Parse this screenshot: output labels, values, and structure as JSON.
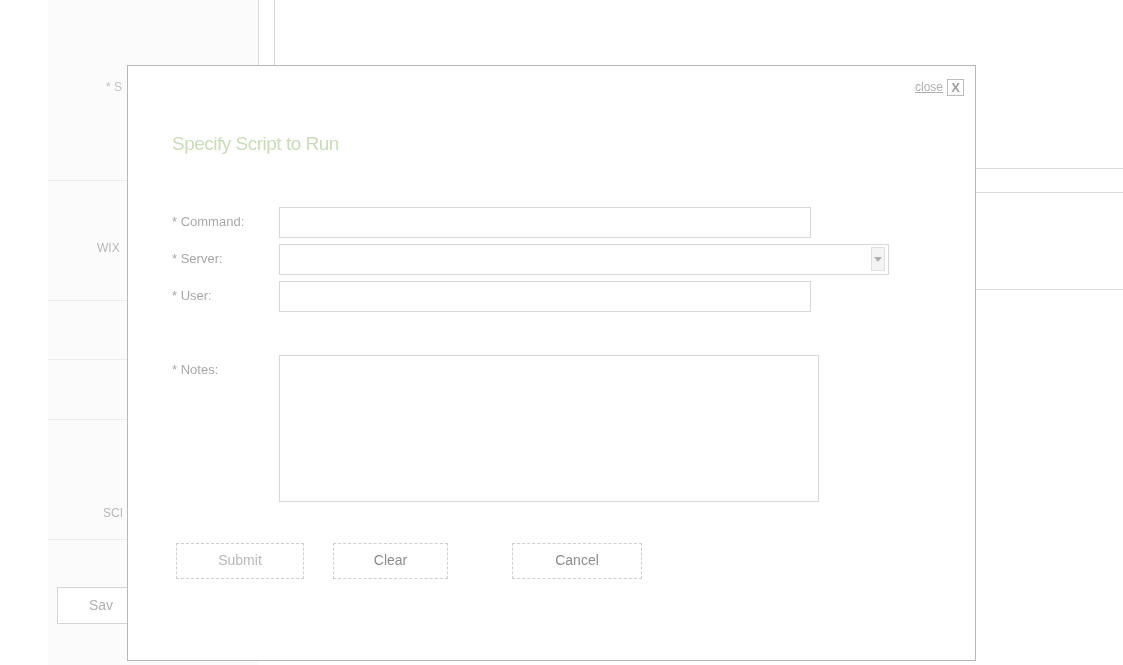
{
  "background": {
    "labels": [
      "* S",
      "WIX",
      "SCI"
    ],
    "save_button": "Sav"
  },
  "dialog": {
    "close_link": "close",
    "close_icon": "X",
    "title": "Specify Script to Run",
    "fields": [
      {
        "kind": "text",
        "label": "* Command:"
      },
      {
        "kind": "select",
        "label": "* Server:"
      },
      {
        "kind": "text",
        "label": "* User:"
      },
      {
        "kind": "textarea",
        "label": "* Notes:"
      }
    ],
    "buttons": [
      {
        "label": "Submit",
        "disabled": true
      },
      {
        "label": "Clear",
        "disabled": false
      },
      {
        "label": "Cancel",
        "disabled": false
      }
    ]
  }
}
